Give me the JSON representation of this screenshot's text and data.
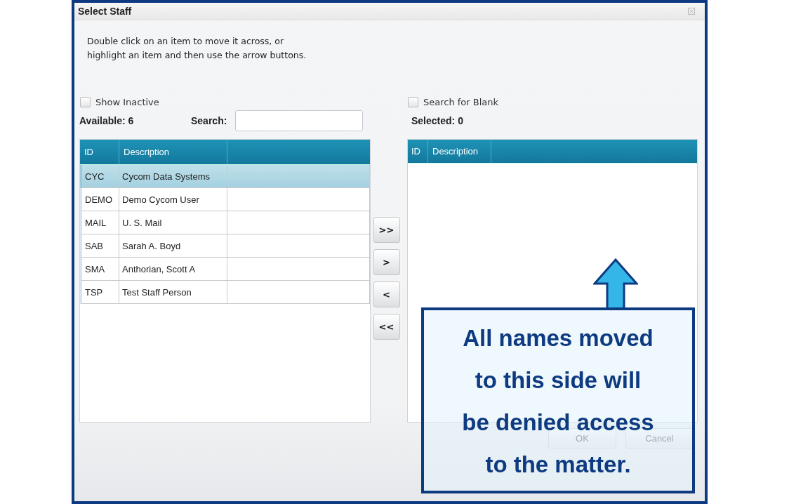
{
  "window": {
    "title": "Select Staff"
  },
  "instructions": "Double click on an item to move it across, or\nhighlight an item and then use the arrow buttons.",
  "show_inactive": {
    "label": "Show Inactive",
    "checked": false
  },
  "search_for_blank": {
    "label": "Search for Blank",
    "checked": false
  },
  "available_label": "Available: 6",
  "search": {
    "label": "Search:"
  },
  "selected_label": "Selected: 0",
  "available_table": {
    "columns": [
      "ID",
      "Description"
    ],
    "rows": [
      {
        "id": "CYC",
        "description": "Cycom Data Systems",
        "selected": true
      },
      {
        "id": "DEMO",
        "description": "Demo Cycom User",
        "selected": false
      },
      {
        "id": "MAIL",
        "description": "U. S. Mail",
        "selected": false
      },
      {
        "id": "SAB",
        "description": "Sarah A. Boyd",
        "selected": false
      },
      {
        "id": "SMA",
        "description": "Anthorian, Scott A",
        "selected": false
      },
      {
        "id": "TSP",
        "description": "Test Staff Person",
        "selected": false
      }
    ]
  },
  "selected_table": {
    "columns": [
      "ID",
      "Description"
    ]
  },
  "move_buttons": [
    ">>",
    ">",
    "<",
    "<<"
  ],
  "buttons": [
    "OK",
    "Cancel"
  ],
  "callout": {
    "text": "All names moved\nto this side will\nbe denied access\nto the matter."
  }
}
